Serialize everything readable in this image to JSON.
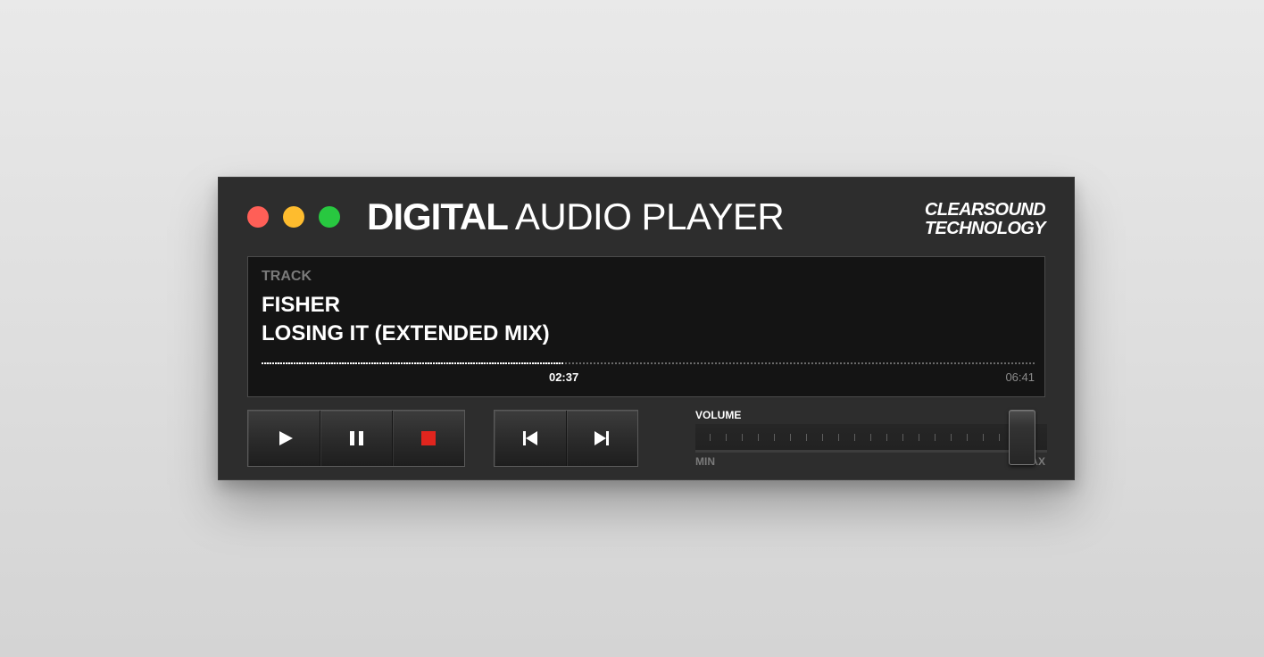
{
  "window": {
    "controls": [
      "close",
      "minimize",
      "maximize"
    ],
    "title_bold": "DIGITAL",
    "title_light": "AUDIO PLAYER"
  },
  "brand": {
    "line1": "CLEARSOUND",
    "line2": "TECHNOLOGY"
  },
  "display": {
    "label": "TRACK",
    "artist": "FISHER",
    "song": "LOSING IT (EXTENDED MIX)",
    "elapsed": "02:37",
    "duration": "06:41",
    "progress": 0.391
  },
  "transport": {
    "play_icon": "play-icon",
    "pause_icon": "pause-icon",
    "stop_icon": "stop-icon",
    "stop_color": "#e0251e",
    "prev_icon": "skip-previous-icon",
    "next_icon": "skip-next-icon"
  },
  "volume": {
    "label": "VOLUME",
    "min_label": "MIN",
    "max_label": "MAX",
    "level": 0.93
  },
  "colors": {
    "close": "#ff5f57",
    "minimize": "#febc2e",
    "maximize": "#28c840",
    "panel": "#2d2d2d",
    "display_bg": "#141414"
  }
}
